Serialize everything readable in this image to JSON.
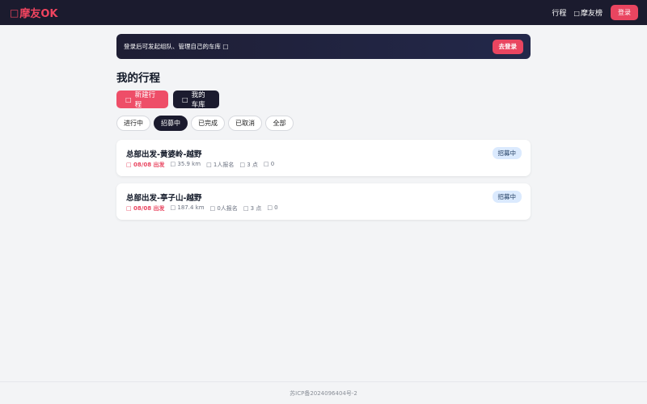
{
  "header": {
    "logo_icon": "□",
    "logo_text": "摩友OK",
    "nav": {
      "trips_label": "行程",
      "leaderboard_icon": "□",
      "leaderboard_label": "摩友榜",
      "login_label": "登录"
    }
  },
  "banner": {
    "text": "登录后可发起组队、管理自己的车库 □",
    "button_label": "去登录"
  },
  "page_title": "我的行程",
  "actions": {
    "new_trip_icon": "□",
    "new_trip_label": "新建行程",
    "garage_icon": "□",
    "garage_label": "我的车库"
  },
  "filters": [
    {
      "label": "进行中",
      "active": false
    },
    {
      "label": "招募中",
      "active": true
    },
    {
      "label": "已完成",
      "active": false
    },
    {
      "label": "已取消",
      "active": false
    },
    {
      "label": "全部",
      "active": false
    }
  ],
  "trips": [
    {
      "title": "总部出发-黄婆岭-越野",
      "date": "□ 08/08 出发",
      "distance": "□ 35.9 km",
      "signups": "□ 1人报名",
      "points": "□ 3 点",
      "comments": "□ 0",
      "status": "招募中"
    },
    {
      "title": "总部出发-亭子山-越野",
      "date": "□ 08/08 出发",
      "distance": "□ 187.4 km",
      "signups": "□ 0人报名",
      "points": "□ 3 点",
      "comments": "□ 0",
      "status": "招募中"
    }
  ],
  "footer": {
    "icp": "苏ICP备2024096404号-2"
  },
  "colors": {
    "brand": "#e94560",
    "dark": "#1b1b2e",
    "badge_bg": "#dbeafe"
  }
}
